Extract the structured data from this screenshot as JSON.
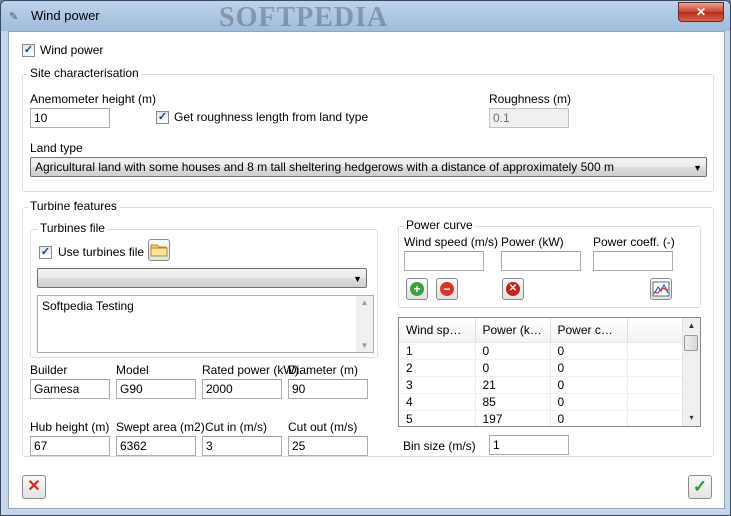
{
  "window": {
    "title": "Wind power",
    "watermark": "SOFTPEDIA",
    "close_label": "✕"
  },
  "wind_power_checkbox": {
    "label": "Wind power",
    "checked": true
  },
  "site": {
    "title": "Site characterisation",
    "anemometer_label": "Anemometer height (m)",
    "anemometer_value": "10",
    "roughness_from_land_label": "Get roughness length from land type",
    "roughness_from_land_checked": true,
    "roughness_label": "Roughness (m)",
    "roughness_value": "0.1",
    "land_type_label": "Land type",
    "land_type_value": "Agricultural land with some houses and 8 m tall sheltering hedgerows with a distance of approximately 500 m"
  },
  "turbine": {
    "title": "Turbine features",
    "file_group_title": "Turbines file",
    "use_file_label": "Use turbines file",
    "use_file_checked": true,
    "file_combo_value": "",
    "notes": "Softpedia Testing",
    "builder_label": "Builder",
    "builder_value": "Gamesa",
    "model_label": "Model",
    "model_value": "G90",
    "rated_label": "Rated power (kW)",
    "rated_value": "2000",
    "diameter_label": "Diameter (m)",
    "diameter_value": "90",
    "hub_label": "Hub height (m)",
    "hub_value": "67",
    "swept_label": "Swept area (m2)",
    "swept_value": "6362",
    "cutin_label": "Cut in (m/s)",
    "cutin_value": "3",
    "cutout_label": "Cut out (m/s)",
    "cutout_value": "25"
  },
  "power_curve": {
    "title": "Power curve",
    "wind_label": "Wind speed (m/s)",
    "power_label": "Power (kW)",
    "coeff_label": "Power coeff. (-)",
    "wind_input": "",
    "power_input": "",
    "coeff_input": "",
    "columns": [
      "Wind spee...",
      "Power (kW)",
      "Power coef..."
    ],
    "rows": [
      [
        "1",
        "0",
        "0"
      ],
      [
        "2",
        "0",
        "0"
      ],
      [
        "3",
        "21",
        "0"
      ],
      [
        "4",
        "85",
        "0"
      ],
      [
        "5",
        "197",
        "0"
      ]
    ],
    "bin_label": "Bin size (m/s)",
    "bin_value": "1"
  },
  "icons": {
    "add": "plus-circle-green",
    "remove": "minus-circle-red",
    "delete": "x-circle-red",
    "chart": "chart-icon",
    "folder": "folder-icon",
    "cancel": "red-x",
    "ok": "green-check"
  },
  "glyphs": {
    "check": "✓",
    "plus": "+",
    "minus": "−",
    "x": "✕",
    "arrow_down": "▼",
    "arrow_up": "▲",
    "scroll_down": "▾"
  }
}
